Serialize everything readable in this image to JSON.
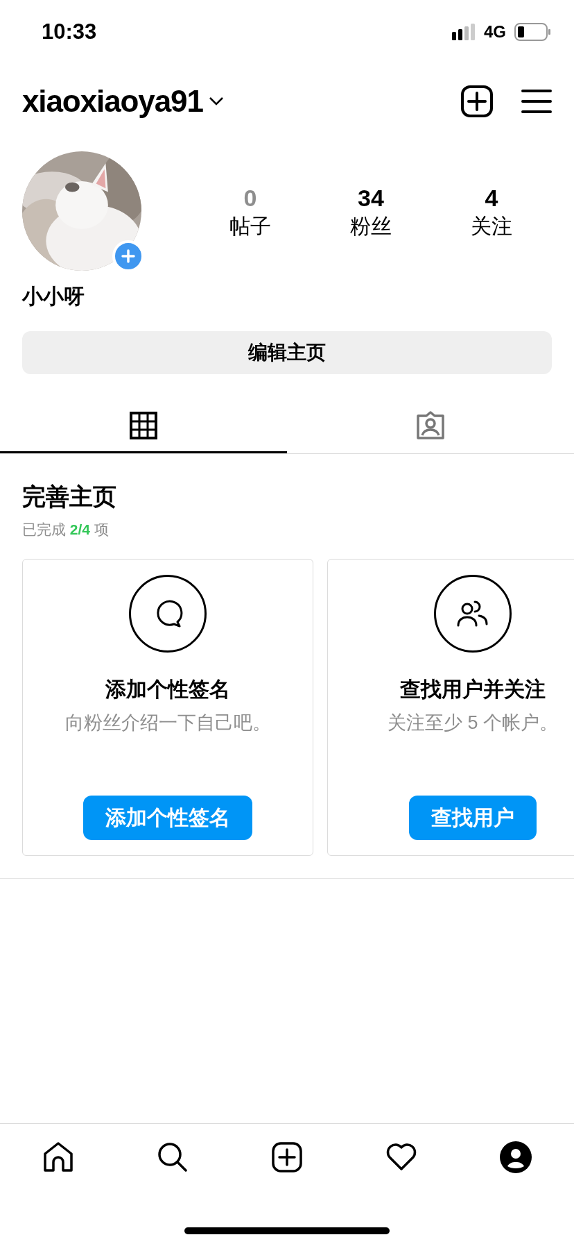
{
  "status_bar": {
    "time": "10:33",
    "network": "4G"
  },
  "header": {
    "username": "xiaoxiaoya91"
  },
  "profile": {
    "name": "小小呀",
    "stats": [
      {
        "value": "0",
        "label": "帖子",
        "muted": true
      },
      {
        "value": "34",
        "label": "粉丝",
        "muted": false
      },
      {
        "value": "4",
        "label": "关注",
        "muted": false
      }
    ],
    "edit_button": "编辑主页"
  },
  "tabs": [
    {
      "kind": "grid",
      "selected": true
    },
    {
      "kind": "tagged",
      "selected": false
    }
  ],
  "complete_profile": {
    "title": "完善主页",
    "progress": {
      "prefix": "已完成",
      "count": "2/4",
      "suffix": "项"
    },
    "cards": [
      {
        "kind": "bio",
        "title": "添加个性签名",
        "description": "向粉丝介绍一下自己吧。",
        "button": "添加个性签名"
      },
      {
        "kind": "people",
        "title": "查找用户并关注",
        "description": "关注至少 5 个帐户。",
        "button": "查找用户"
      }
    ]
  },
  "bottom_nav": [
    {
      "kind": "home"
    },
    {
      "kind": "search"
    },
    {
      "kind": "create"
    },
    {
      "kind": "activity"
    },
    {
      "kind": "profile"
    }
  ]
}
